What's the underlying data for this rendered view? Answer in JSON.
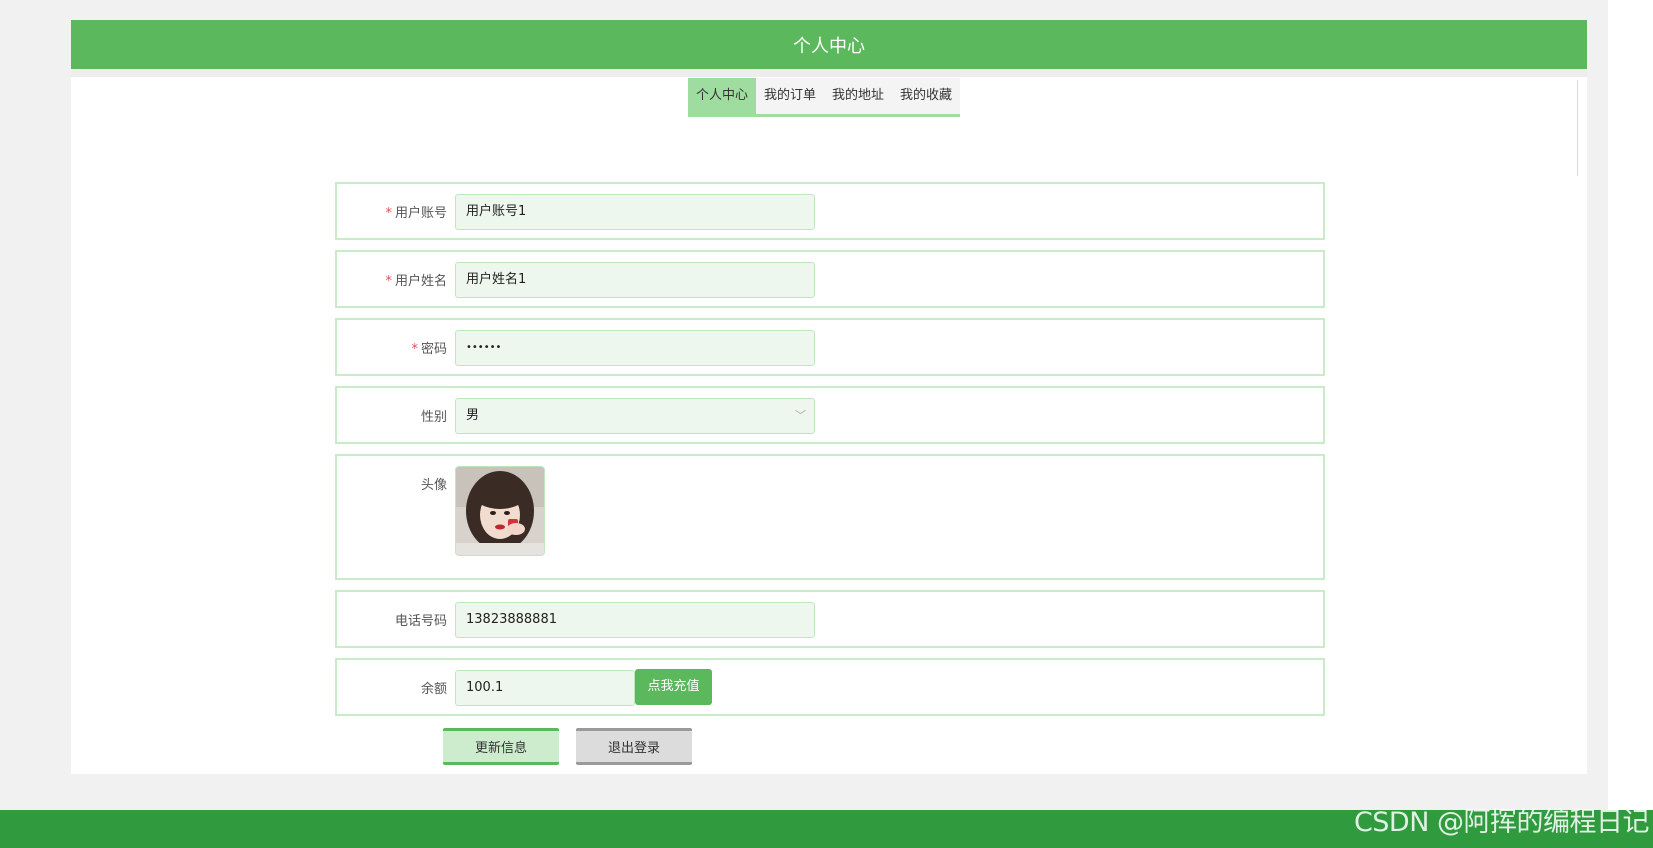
{
  "header": {
    "title": "个人中心"
  },
  "tabs": [
    {
      "label": "个人中心",
      "active": true
    },
    {
      "label": "我的订单",
      "active": false
    },
    {
      "label": "我的地址",
      "active": false
    },
    {
      "label": "我的收藏",
      "active": false
    }
  ],
  "form": {
    "account": {
      "label": "用户账号",
      "required": "*",
      "value": "用户账号1"
    },
    "name": {
      "label": "用户姓名",
      "required": "*",
      "value": "用户姓名1"
    },
    "password": {
      "label": "密码",
      "required": "*",
      "value": "••••••"
    },
    "gender": {
      "label": "性别",
      "value": "男"
    },
    "avatar": {
      "label": "头像"
    },
    "phone": {
      "label": "电话号码",
      "value": "13823888881"
    },
    "balance": {
      "label": "余额",
      "value": "100.1",
      "recharge_label": "点我充值"
    }
  },
  "actions": {
    "update_label": "更新信息",
    "logout_label": "退出登录"
  },
  "watermark": "CSDN @阿挥的编程日记",
  "colors": {
    "accent": "#5cb85c",
    "tab_active": "#9fdc9f",
    "field_bg": "#eef7ee",
    "footer": "#2f9a3e"
  }
}
